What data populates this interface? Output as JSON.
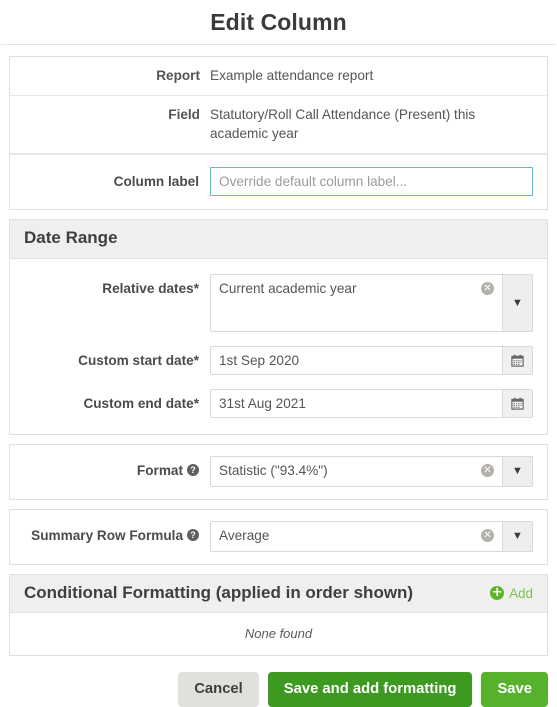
{
  "dialog": {
    "title": "Edit Column"
  },
  "info": {
    "rows": [
      {
        "label": "Report",
        "value": "Example attendance report"
      },
      {
        "label": "Field",
        "value": "Statutory/Roll Call Attendance (Present) this academic year"
      }
    ],
    "column_label": {
      "label": "Column label",
      "value": "",
      "placeholder": "Override default column label..."
    }
  },
  "date_range": {
    "heading": "Date Range",
    "relative_dates": {
      "label": "Relative dates*",
      "value": "Current academic year",
      "clear_glyph": "✕",
      "caret_glyph": "▼"
    },
    "custom_start_date": {
      "label": "Custom start date*",
      "value": "1st Sep 2020"
    },
    "custom_end_date": {
      "label": "Custom end date*",
      "value": "31st Aug 2021"
    }
  },
  "format": {
    "label": "Format",
    "help_glyph": "?",
    "value": "Statistic (\"93.4%\")",
    "clear_glyph": "✕",
    "caret_glyph": "▼"
  },
  "summary_row_formula": {
    "label": "Summary Row Formula",
    "help_glyph": "?",
    "value": "Average",
    "clear_glyph": "✕",
    "caret_glyph": "▼"
  },
  "conditional_formatting": {
    "heading": "Conditional Formatting (applied in order shown)",
    "add_label": "Add",
    "plus_glyph": "+",
    "empty_text": "None found"
  },
  "footer": {
    "cancel_label": "Cancel",
    "save_and_add_label": "Save and add formatting",
    "save_label": "Save"
  },
  "colors": {
    "focus_border": "#2bd0e0",
    "save_green": "#56b22c",
    "save_add_green": "#3c9a20",
    "add_link_green": "#7cc24f",
    "panel_heading_bg": "#efefee",
    "cancel_gray": "#e2e0dd"
  }
}
